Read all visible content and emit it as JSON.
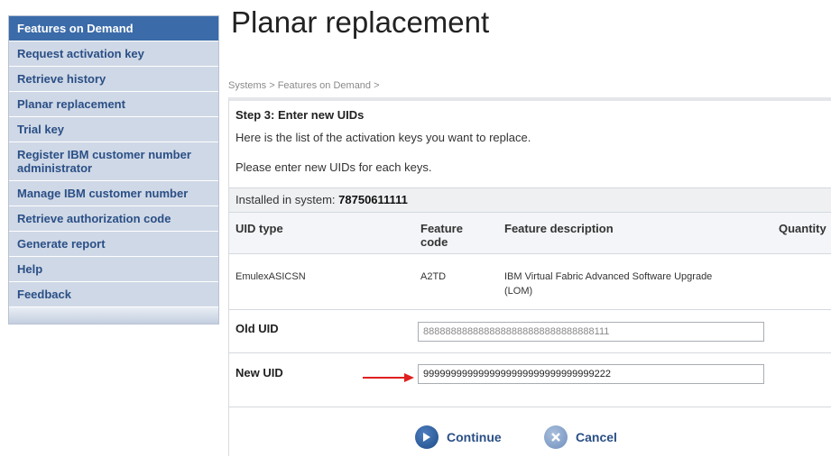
{
  "sidebar": {
    "items": [
      {
        "label": "Features on Demand"
      },
      {
        "label": "Request activation key"
      },
      {
        "label": "Retrieve history"
      },
      {
        "label": "Planar replacement"
      },
      {
        "label": "Trial key"
      },
      {
        "label": "Register IBM customer number administrator"
      },
      {
        "label": "Manage IBM customer number"
      },
      {
        "label": "Retrieve authorization code"
      },
      {
        "label": "Generate report"
      },
      {
        "label": "Help"
      },
      {
        "label": "Feedback"
      }
    ]
  },
  "page": {
    "title": "Planar replacement",
    "breadcrumb": "Systems > Features on Demand >"
  },
  "step": {
    "title": "Step 3: Enter new UIDs",
    "intro1": "Here is the list of the activation keys you want to replace.",
    "intro2": "Please enter new UIDs for each keys."
  },
  "installed": {
    "label": "Installed in system: ",
    "system": "78750611111"
  },
  "table": {
    "headers": {
      "uid_type": "UID type",
      "feature_code": "Feature code",
      "feature_description": "Feature description",
      "quantity": "Quantity"
    },
    "row": {
      "uid_type": "EmulexASICSN",
      "feature_code": "A2TD",
      "feature_description": "IBM Virtual Fabric Advanced Software Upgrade (LOM)"
    }
  },
  "old_uid": {
    "label": "Old UID",
    "value": "8888888888888888888888888888888111"
  },
  "new_uid": {
    "label": "New UID",
    "value": "9999999999999999999999999999999222"
  },
  "actions": {
    "continue_label": "Continue",
    "cancel_label": "Cancel"
  },
  "colors": {
    "sidebar_active": "#3b6ba9",
    "sidebar_bg": "#cfd8e6",
    "link_blue": "#2a4f86",
    "arrow_red": "#e02020"
  },
  "icons": {
    "continue": "arrow-right-circle-icon",
    "cancel": "x-circle-icon",
    "annotation": "red-arrow-icon"
  }
}
